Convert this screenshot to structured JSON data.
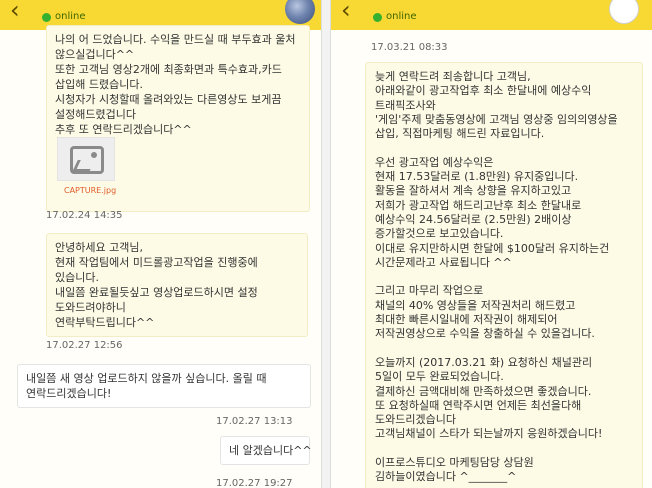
{
  "left": {
    "header": {
      "name": "  ",
      "status": "online"
    },
    "messages": [
      {
        "lines": [
          "나의 어 드었습니다. 수익을 만드실 때 부두효과 울처",
          "않으실겁니다^^",
          "또한 고객님 영상2개에 최종화면과 특수효과,카드",
          "삽입해 드렸습니다.",
          "시청자가 시청할때 올려와있는 다른영상도 보게끔",
          "설정해드렸겁니다",
          "추후 또 연락드리겠습니다^^"
        ],
        "attachment": "CAPTURE.jpg",
        "time": "17.02.24 14:35"
      },
      {
        "lines": [
          "안녕하세요 고객님,",
          "현재 작업팀에서 미드롤광고작업을 진행중에",
          "있습니다.",
          "내일쯤 완료될듯싶고 영상업로드하시면 설정",
          "도와드려야하니",
          "연락부탁드립니다^^"
        ],
        "time": "17.02.27 12:56"
      },
      {
        "lines": [
          "내일쯤 새 영상 업로드하지 않을까 싶습니다. 올릴 때",
          "연락드리겠습니다!"
        ],
        "time": "17.02.27 13:13"
      },
      {
        "lines": [
          "네 알겠습니다^^"
        ],
        "time": "17.02.27 19:27"
      }
    ]
  },
  "right": {
    "header": {
      "name": "     ",
      "status": "online"
    },
    "messages": [
      {
        "time": "17.03.21 08:33",
        "lines": [
          "늦게 연락드려 죄송합니다 고객님,",
          "아래와같이 광고작업후 최소 한달내에 예상수익",
          "트래픽조사와",
          "'게임'주제 맞춤동영상에 고객님 영상중 임의의영상을",
          "삽입, 직접마케팅 해드린 자료입니다.",
          "",
          "우선 광고작업 예상수익은",
          "현재 17.53달러로 (1.8만원) 유지중입니다.",
          "활동을 잘하셔서 계속 상향을 유지하고있고",
          "저희가 광고작업 해드리고난후 최소 한달내로",
          "예상수익 24.56달러로 (2.5만원) 2배이상",
          "증가할것으로 보고있습니다.",
          "이대로 유지만하시면 한달에 $100달러 유지하는건",
          "시간문제라고 사료됩니다 ^^",
          "",
          "그리고 마무리 작업으로",
          "채널의 40% 영상들을 저작권처리 해드렸고",
          "최대한 빠른시일내에 저작권이 해제되어",
          "저작권영상으로 수익을 창출하실 수 있을겁니다.",
          "",
          "오늘까지 (2017.03.21 화) 요청하신 채널관리",
          "5일이 모두 완료되었습니다.",
          "결제하신 금액대비해 만족하셨으면 좋겠습니다.",
          "또 요청하실때 연락주시면 언제든 최선을다해",
          "도와드리겠습니다",
          "고객님채널이 스타가 되는날까지 응원하겠습니다!",
          "",
          "이프로스튜디오 마케팅담당 상담원",
          "김하늘이였습니다 ^_______^"
        ]
      }
    ]
  }
}
